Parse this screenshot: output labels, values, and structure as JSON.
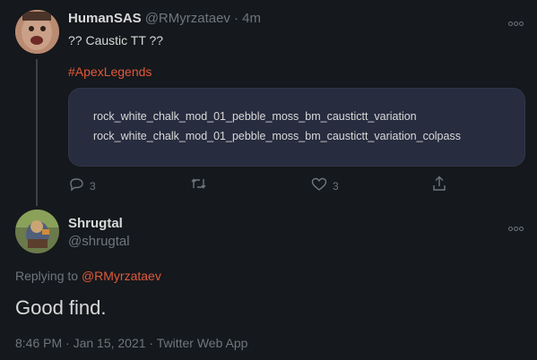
{
  "tweet1": {
    "author": "HumanSAS",
    "handle": "@RMyrzataev",
    "time": "· 4m",
    "text": "?? Caustic TT ??",
    "hashtag": "#ApexLegends",
    "code_lines": [
      "rock_white_chalk_mod_01_pebble_moss_bm_caustictt_variation",
      "rock_white_chalk_mod_01_pebble_moss_bm_caustictt_variation_colpass"
    ],
    "reply_count": "3",
    "like_count": "3"
  },
  "tweet2": {
    "author": "Shrugtal",
    "handle": "@shrugtal",
    "replying_prefix": "Replying to",
    "replying_to": "@RMyrzataev",
    "text": "Good find.",
    "meta": "8:46 PM · Jan 15, 2021 · Twitter Web App"
  },
  "colors": {
    "background": "#15181c",
    "accent": "#e0593a",
    "codebox": "#272c3f",
    "muted": "#6e767d"
  }
}
